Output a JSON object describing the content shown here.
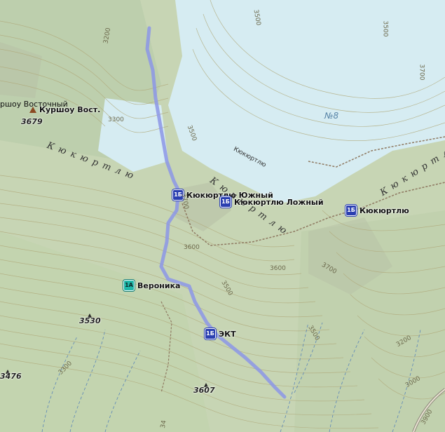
{
  "passes": [
    {
      "name": "Кюкюртлю Южный",
      "category": "1Б"
    },
    {
      "name": "Кюкюртлю Ложный",
      "category": "1Б"
    },
    {
      "name": "Кюкюртлю",
      "category": "1Б"
    },
    {
      "name": "ЭКТ",
      "category": "1Б"
    },
    {
      "name": "Вероника",
      "category": "1А"
    }
  ],
  "peaks": [
    {
      "name": "Куршоу Вост.",
      "elevation": "3679"
    },
    {
      "name": "",
      "elevation": "3530"
    },
    {
      "name": "",
      "elevation": "3607"
    },
    {
      "name": "",
      "elevation": "3476"
    }
  ],
  "partial_labels": {
    "kurshou_full": "ршоу Восточный",
    "edge_elev": "34"
  },
  "ridges": {
    "left": "Кюкюртлю",
    "center": "Кюкюртлю",
    "right": "Кюкюртлю"
  },
  "glacier_label": "№8",
  "small_label": "Кюкюртлю",
  "contour_labels": [
    "3200",
    "3300",
    "3500",
    "3500",
    "3700",
    "3700",
    "3600",
    "3600",
    "3500",
    "3700",
    "3500",
    "3300",
    "3200",
    "3000",
    "3900",
    "3500"
  ],
  "colors": {
    "terrain": "#c9d6b8",
    "glacier": "#d6ecf2",
    "route": "#8c96e6",
    "pass_badge": "#2a3fb0",
    "pass_badge_1a": "#1fb7a8",
    "peak_triangle": "#8b4a22"
  }
}
